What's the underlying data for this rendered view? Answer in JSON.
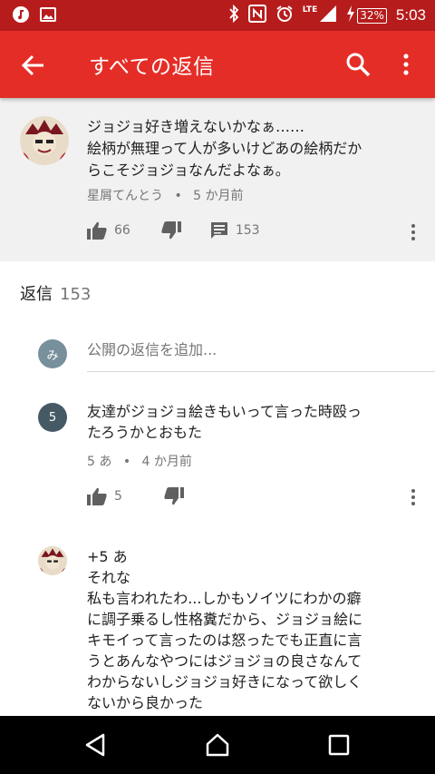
{
  "status_bar": {
    "network": "LTE",
    "battery": "32%",
    "time": "5:03",
    "icons": [
      "music-icon",
      "image-icon",
      "bluetooth-icon",
      "nfc-icon",
      "alarm-icon",
      "signal-icon",
      "charging-icon",
      "battery-icon"
    ]
  },
  "app_bar": {
    "title": "すべての返信",
    "background": "#e52d27"
  },
  "parent_comment": {
    "lines": [
      "ジョジョ好き増えないかなぁ……",
      "絵柄が無理って人が多いけどあの絵柄だか",
      "らこそジョジョなんだよなぁ。"
    ],
    "author": "星屑てんとう",
    "separator": "•",
    "time": "5 か月前",
    "likes": "66",
    "replies": "153"
  },
  "replies_header": {
    "label": "返信",
    "count": "153"
  },
  "add_reply": {
    "avatar_letter": "み",
    "placeholder": "公開の返信を追加..."
  },
  "replies": [
    {
      "avatar_letter": "5",
      "lines": [
        "友達がジョジョ絵きもいって言った時殴っ",
        "たろうかとおもた"
      ],
      "author": "5 あ",
      "separator": "•",
      "time": "4 か月前",
      "likes": "5"
    },
    {
      "lines": [
        "+5 あ",
        "それな",
        "私も言われたわ...しかもソイツにわかの癖",
        "に調子乗るし性格糞だから、ジョジョ絵に",
        "キモイって言ったのは怒ったでも正直に言",
        "うとあんなやつにはジョジョの良さなんて",
        "わからないしジョジョ好きになって欲しく",
        "ないから良かった"
      ]
    }
  ]
}
